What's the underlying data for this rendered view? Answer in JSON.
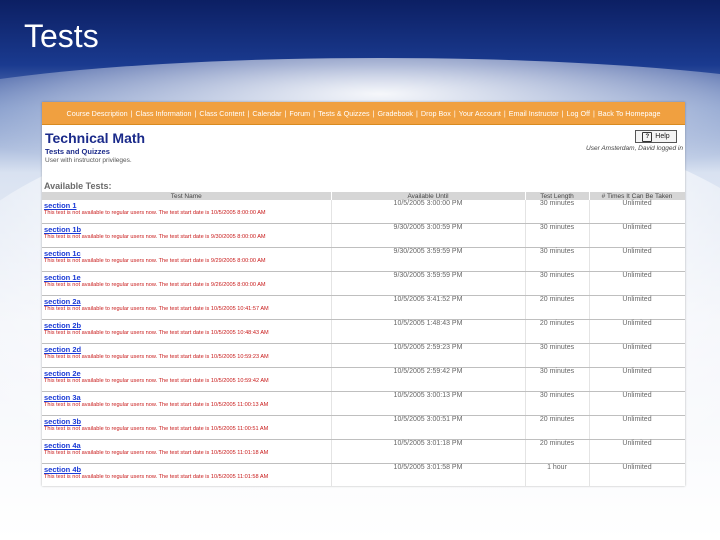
{
  "slide": {
    "title": "Tests"
  },
  "nav": {
    "items": [
      "Course Description",
      "Class Information",
      "Class Content",
      "Calendar",
      "Forum",
      "Tests & Quizzes",
      "Gradebook",
      "Drop Box",
      "Your Account",
      "Email Instructor",
      "Log Off",
      "Back To Homepage"
    ]
  },
  "header": {
    "course_title": "Technical Math",
    "page_subtitle": "Tests and Quizzes",
    "privilege_note": "User with instructor privileges.",
    "help_label": "Help",
    "user_line": "User Amsterdam, David logged in"
  },
  "tests": {
    "heading": "Available Tests:",
    "columns": [
      "Test Name",
      "Available Until",
      "Test Length",
      "# Times It Can Be Taken"
    ],
    "rows": [
      {
        "name": "section 1",
        "message": "This test is not available to regular users now. The test start date is 10/5/2005 8:00:00 AM",
        "until": "10/5/2005 3:00:00 PM",
        "length": "30 minutes",
        "times": "Unlimited"
      },
      {
        "name": "section 1b",
        "message": "This test is not available to regular users now. The test start date is 9/30/2005 8:00:00 AM",
        "until": "9/30/2005 3:00:59 PM",
        "length": "30 minutes",
        "times": "Unlimited"
      },
      {
        "name": "section 1c",
        "message": "This test is not available to regular users now. The test start date is 9/29/2005 8:00:00 AM",
        "until": "9/30/2005 3:59:59 PM",
        "length": "30 minutes",
        "times": "Unlimited"
      },
      {
        "name": "section 1e",
        "message": "This test is not available to regular users now. The test start date is 9/26/2005 8:00:00 AM",
        "until": "9/30/2005 3:59:59 PM",
        "length": "30 minutes",
        "times": "Unlimited"
      },
      {
        "name": "section 2a",
        "message": "This test is not available to regular users now. The test start date is 10/5/2005 10:41:57 AM",
        "until": "10/5/2005 3:41:52 PM",
        "length": "20 minutes",
        "times": "Unlimited"
      },
      {
        "name": "section 2b",
        "message": "This test is not available to regular users now. The test start date is 10/5/2005 10:48:43 AM",
        "until": "10/5/2005 1:48:43 PM",
        "length": "20 minutes",
        "times": "Unlimited"
      },
      {
        "name": "section 2d",
        "message": "This test is not available to regular users now. The test start date is 10/5/2005 10:59:23 AM",
        "until": "10/5/2005 2:59:23 PM",
        "length": "30 minutes",
        "times": "Unlimited"
      },
      {
        "name": "section 2e",
        "message": "This test is not available to regular users now. The test start date is 10/5/2005 10:59:42 AM",
        "until": "10/5/2005 2:59:42 PM",
        "length": "30 minutes",
        "times": "Unlimited"
      },
      {
        "name": "section 3a",
        "message": "This test is not available to regular users now. The test start date is 10/5/2005 11:00:13 AM",
        "until": "10/5/2005 3:00:13 PM",
        "length": "30 minutes",
        "times": "Unlimited"
      },
      {
        "name": "section 3b",
        "message": "This test is not available to regular users now. The test start date is 10/5/2005 11:00:51 AM",
        "until": "10/5/2005 3:00:51 PM",
        "length": "20 minutes",
        "times": "Unlimited"
      },
      {
        "name": "section 4a",
        "message": "This test is not available to regular users now. The test start date is 10/5/2005 11:01:18 AM",
        "until": "10/5/2005 3:01:18 PM",
        "length": "20 minutes",
        "times": "Unlimited"
      },
      {
        "name": "section 4b",
        "message": "This test is not available to regular users now. The test start date is 10/5/2005 11:01:58 AM",
        "until": "10/5/2005 3:01:58 PM",
        "length": "1 hour",
        "times": "Unlimited"
      }
    ]
  }
}
